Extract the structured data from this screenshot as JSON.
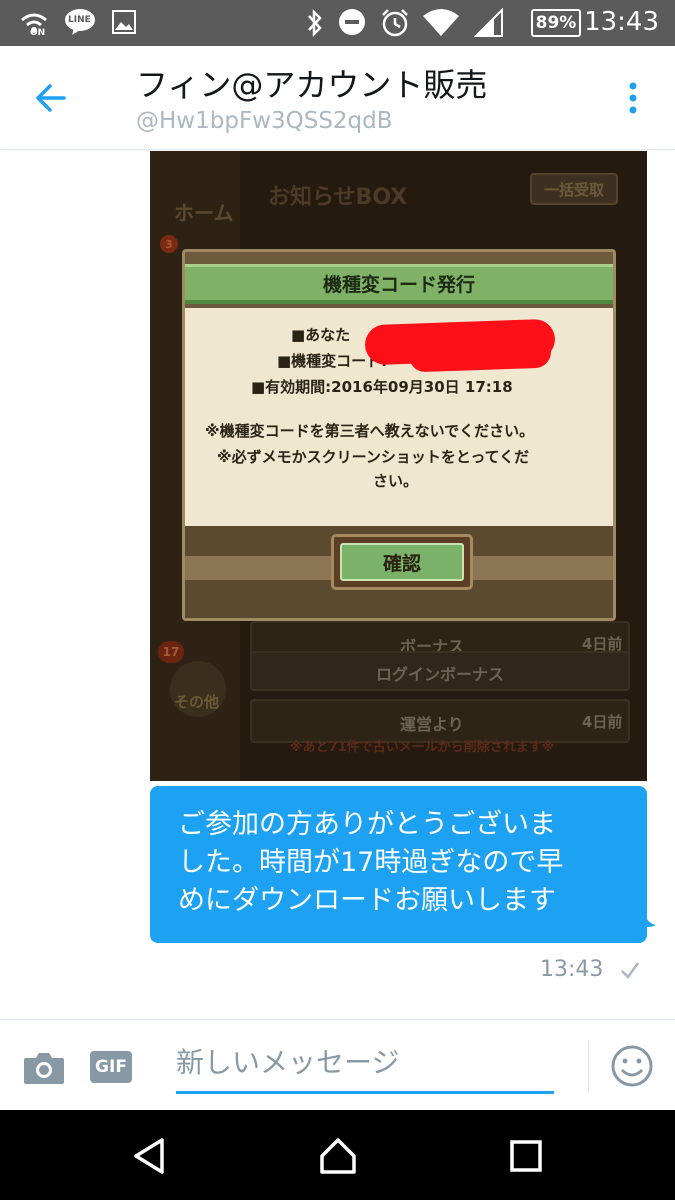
{
  "status_bar": {
    "time": "13:43",
    "battery": "89%",
    "icons": [
      "wifi-calling-icon",
      "line-app-icon",
      "gallery-icon",
      "bluetooth-icon",
      "do-not-disturb-icon",
      "alarm-icon",
      "wifi-icon",
      "signal-icon",
      "battery-icon"
    ],
    "line_label": "LINE",
    "on_label": "ON"
  },
  "header": {
    "title": "フィン@アカウント販売",
    "handle": "@Hw1bpFw3QSS2qdB"
  },
  "media": {
    "game_title": "お知らせBOX",
    "bulk_button": "一括受取",
    "home_label": "ホーム",
    "other_label": "その他",
    "badge_top": "3",
    "badge_other": "17",
    "dialog_title": "機種変コード発行",
    "line_user": "■あなた",
    "line_code": "■機種変コード:",
    "line_expiry": "■有効期間:2016年09月30日 17:18",
    "note_1": "※機種変コードを第三者へ教えないでください。",
    "note_2": "※必ずメモかスクリーンショットをとってくだ",
    "note_3": "さい。",
    "confirm_label": "確認",
    "row_1_title": "ボーナス",
    "row_1_date": "4日前",
    "row_2_title": "ログインボーナス",
    "row_3_title": "運営より",
    "row_3_date": "4日前",
    "footer_note": "※あと71件で古いメールから削除されます※"
  },
  "message": {
    "line_1": "ご参加の方ありがとうございま",
    "line_2": "した。時間が17時過ぎなので早",
    "line_3": "めにダウンロードお願いします",
    "time": "13:43"
  },
  "composer": {
    "placeholder": "新しいメッセージ",
    "gif_label": "GIF"
  },
  "colors": {
    "accent": "#1da1f2",
    "status_bar": "#5b5b5b",
    "nav_bar": "#000000"
  }
}
